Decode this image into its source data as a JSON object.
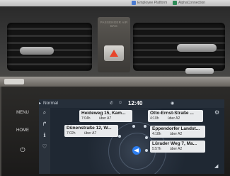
{
  "browser_tabs": {
    "tab_1": "Employee Platform",
    "tab_2": "AlphaConnection"
  },
  "dashboard": {
    "airbag_label": "PASSENGER AIR BAG"
  },
  "hard_buttons": {
    "menu": "MENU",
    "home": "HOME"
  },
  "status": {
    "mode": "Normal",
    "time": "12:40"
  },
  "destinations": [
    {
      "name": "Heideweg 15, Kam...",
      "duration": "7:04h",
      "via": "über A7"
    },
    {
      "name": "Otto-Ernst-Straße ...",
      "duration": "4:10h",
      "via": "über A2"
    },
    {
      "name": "Dünenstraße 12, W...",
      "duration": "7:02h",
      "via": "über A7"
    },
    {
      "name": "Eppendorfer Landst...",
      "duration": "4:18h",
      "via": "über A2"
    },
    {
      "name": "Lürader Weg 7, Ma...",
      "duration": "5:57h",
      "via": "über A2"
    }
  ],
  "icons": {
    "hazard": "hazard-triangle-icon",
    "navigation": "navigation-arrow-icon",
    "settings": "gear-icon"
  },
  "colors": {
    "hazard": "#e8452a",
    "position_marker": "#2d7ef0",
    "card_background": "#e8eaec"
  }
}
